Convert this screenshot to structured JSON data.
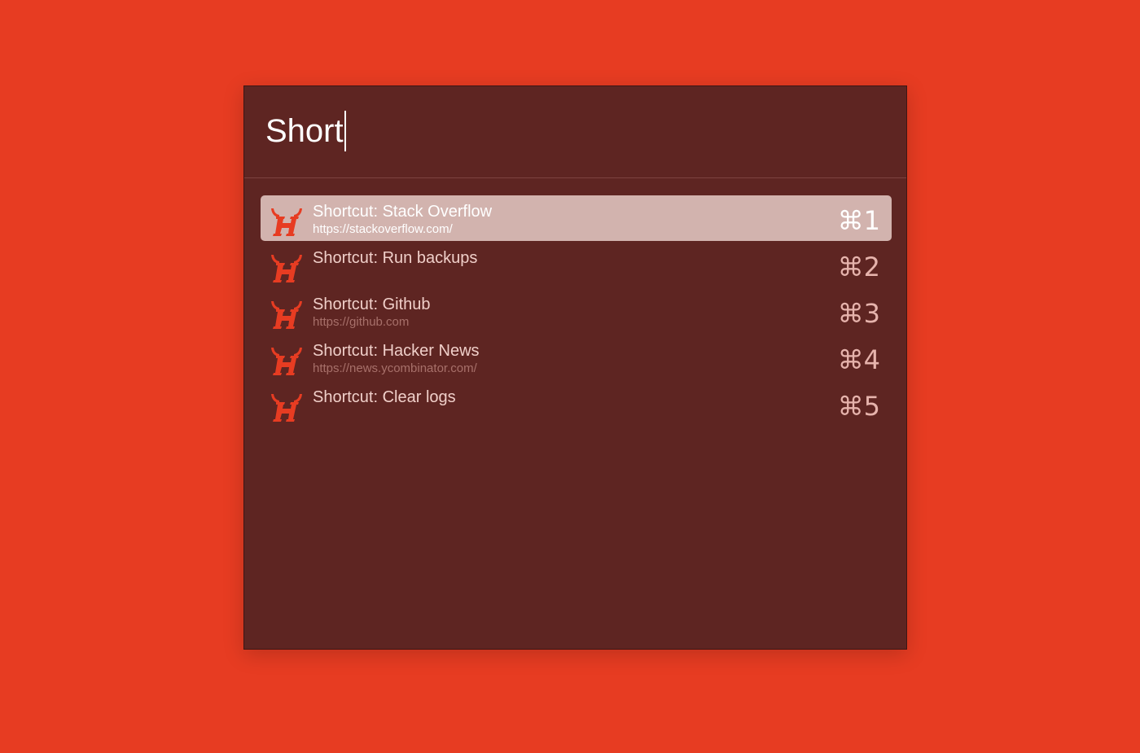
{
  "colors": {
    "background": "#e73c22",
    "panel": "#5e2522",
    "selected_row": "#d2b3ae",
    "icon": "#e73c22"
  },
  "search": {
    "value": "Short"
  },
  "results": [
    {
      "title": "Shortcut: Stack Overflow",
      "subtitle": "https://stackoverflow.com/",
      "shortcut": "⌘1",
      "icon": "horned-h-icon",
      "selected": true
    },
    {
      "title": "Shortcut: Run backups",
      "subtitle": "",
      "shortcut": "⌘2",
      "icon": "horned-h-icon",
      "selected": false
    },
    {
      "title": "Shortcut: Github",
      "subtitle": "https://github.com",
      "shortcut": "⌘3",
      "icon": "horned-h-icon",
      "selected": false
    },
    {
      "title": "Shortcut: Hacker News",
      "subtitle": "https://news.ycombinator.com/",
      "shortcut": "⌘4",
      "icon": "horned-h-icon",
      "selected": false
    },
    {
      "title": "Shortcut: Clear logs",
      "subtitle": "",
      "shortcut": "⌘5",
      "icon": "horned-h-icon",
      "selected": false
    }
  ]
}
